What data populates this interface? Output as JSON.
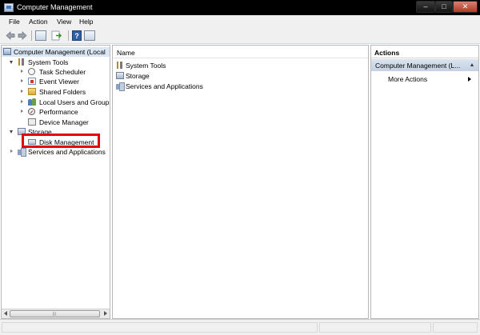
{
  "window": {
    "title": "Computer Management",
    "minimize_glyph": "–",
    "maximize_glyph": "□",
    "close_glyph": "✕"
  },
  "menu": {
    "file": "File",
    "action": "Action",
    "view": "View",
    "help": "Help"
  },
  "toolbar": {
    "back_glyph": "⇦",
    "forward_glyph": "⇨",
    "help_glyph": "?"
  },
  "tree": {
    "root": "Computer Management (Local",
    "system_tools": "System Tools",
    "task_scheduler": "Task Scheduler",
    "event_viewer": "Event Viewer",
    "shared_folders": "Shared Folders",
    "local_users": "Local Users and Groups",
    "performance": "Performance",
    "device_manager": "Device Manager",
    "storage": "Storage",
    "disk_management": "Disk Management",
    "services": "Services and Applications",
    "scroll_grip": "|||"
  },
  "list": {
    "column_name": "Name",
    "items": [
      "System Tools",
      "Storage",
      "Services and Applications"
    ]
  },
  "actions": {
    "title": "Actions",
    "group": "Computer Management (L...",
    "more": "More Actions"
  },
  "colors": {
    "highlight_box": "#e4000f",
    "selection": "#dbe6f4",
    "title_bar": "#000000"
  },
  "icons": {
    "root": "computer-management-icon",
    "system_tools": "tools-icon",
    "task_scheduler": "clock-icon",
    "event_viewer": "event-log-icon",
    "shared_folders": "folder-icon",
    "local_users": "users-icon",
    "performance": "gauge-icon",
    "device_manager": "device-icon",
    "storage": "storage-icon",
    "disk_management": "disk-icon",
    "services": "services-icon"
  }
}
